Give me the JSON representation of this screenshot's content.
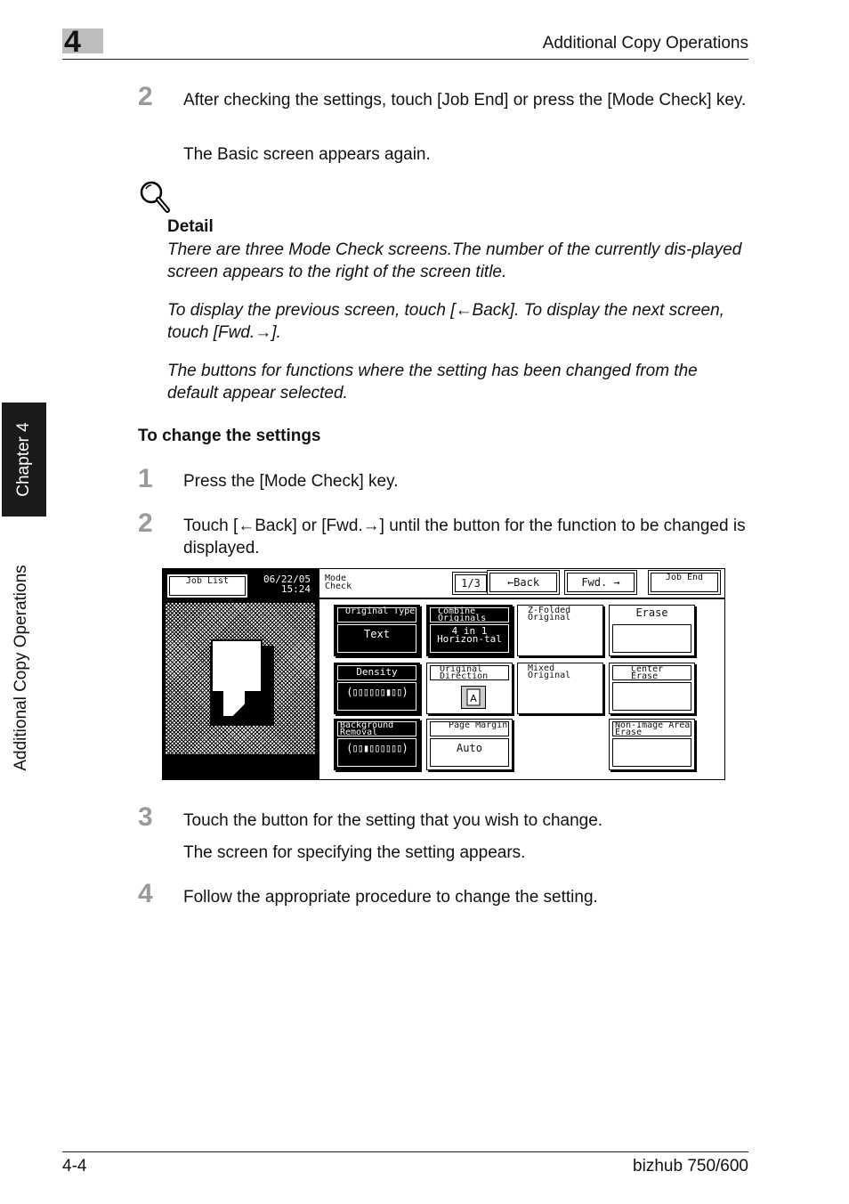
{
  "header": {
    "chapter_number": "4",
    "title": "Additional Copy Operations"
  },
  "side": {
    "tab_label": "Chapter 4",
    "section_label": "Additional Copy Operations"
  },
  "step_top": {
    "number": "2",
    "text": "After checking the settings, touch [Job End] or press the [Mode Check] key.",
    "result": "The Basic screen appears again."
  },
  "detail": {
    "icon": "magnifier-icon",
    "label": "Detail",
    "paragraphs": [
      "There are three Mode Check screens.The number of the currently dis-played screen appears to the right of the screen title.",
      "To display the previous screen, touch [←Back]. To display the next screen, touch [Fwd.→].",
      "The buttons for functions where the setting has been changed from the default appear selected."
    ]
  },
  "section": {
    "heading": "To change the settings"
  },
  "steps": [
    {
      "number": "1",
      "text": "Press the [Mode Check] key."
    },
    {
      "number": "2",
      "text": "Touch [←Back] or [Fwd.→] until the button for the function to be changed is displayed."
    },
    {
      "number": "3",
      "text": "Touch the button for the setting that you wish to change.",
      "result": "The screen for specifying the setting appears."
    },
    {
      "number": "4",
      "text": "Follow the appropriate procedure to change the setting."
    }
  ],
  "screen": {
    "job_list": "Job List",
    "date": "06/22/05",
    "time": "15:24",
    "title": "Mode Check",
    "page": "1/3",
    "back": "←Back",
    "fwd": "Fwd. →",
    "job_end": "Job End",
    "buttons": {
      "original_type": {
        "label": "Original Type",
        "value": "Text"
      },
      "combine": {
        "label": "Combine Originals",
        "value": "4 in 1 Horizon-tal"
      },
      "zfold": {
        "label": "Z-Folded Original"
      },
      "erase": {
        "label": "Erase"
      },
      "density": {
        "label": "Density",
        "value": "(▯▯▯▯▯▯▮▯▯)"
      },
      "direction": {
        "label": "Original Direction"
      },
      "mixed": {
        "label": "Mixed Original"
      },
      "center": {
        "label": "Center Erase"
      },
      "background": {
        "label": "Background Removal",
        "value": "(▯▯▮▯▯▯▯▯▯)"
      },
      "margin": {
        "label": "Page Margin",
        "value": "Auto"
      },
      "nonimage": {
        "label": "Non-Image Area Erase"
      }
    }
  },
  "footer": {
    "page": "4-4",
    "product": "bizhub 750/600"
  }
}
